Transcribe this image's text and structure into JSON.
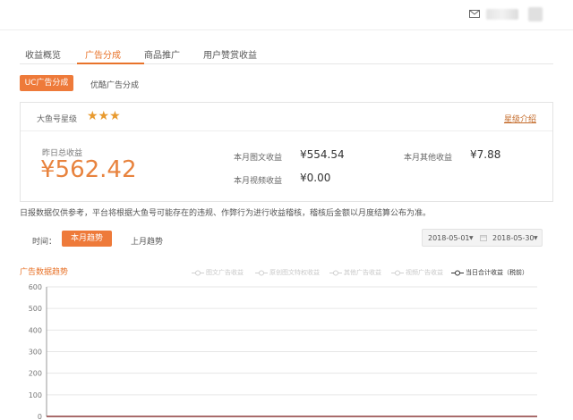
{
  "tabs": [
    {
      "label": "收益概览",
      "active": false
    },
    {
      "label": "广告分成",
      "active": true
    },
    {
      "label": "商品推广",
      "active": false
    },
    {
      "label": "用户赞赏收益",
      "active": false
    }
  ],
  "subtabs": {
    "active": "UC广告分成",
    "other": "优酷广告分成"
  },
  "star_panel": {
    "label": "大鱼号星级",
    "stars": "★★★",
    "link": "星级介绍"
  },
  "earnings": {
    "yesterday_label": "昨日总收益",
    "yesterday_value": "¥562.42",
    "stats": [
      {
        "label": "本月图文收益",
        "value": "¥554.54"
      },
      {
        "label": "本月其他收益",
        "value": "¥7.88"
      },
      {
        "label": "本月视频收益",
        "value": "¥0.00"
      }
    ]
  },
  "notice": "日报数据仅供参考，平台将根据大鱼号可能存在的违规、作弊行为进行收益稽核，稽核后金额以月度结算公布为准。",
  "time": {
    "label": "时间：",
    "active": "本月趋势",
    "other": "上月趋势"
  },
  "date_range": {
    "start": "2018-05-01",
    "end": "2018-05-30"
  },
  "chart_data": {
    "type": "line",
    "title": "广告数据趋势",
    "ylim": [
      0,
      600
    ],
    "yticks": [
      0,
      100,
      200,
      300,
      400,
      500,
      600
    ],
    "grid": true,
    "legend_position": "top-right",
    "series": [
      {
        "name": "图文广告收益",
        "visible": false,
        "values": []
      },
      {
        "name": "原创图文特权收益",
        "visible": false,
        "values": []
      },
      {
        "name": "其他广告收益",
        "visible": false,
        "values": []
      },
      {
        "name": "视频广告收益",
        "visible": false,
        "values": []
      },
      {
        "name": "当日合计收益（税前）",
        "visible": true,
        "values": []
      }
    ],
    "colors": {
      "accent": "#ee7a3a",
      "baseline": "#8b3a3a",
      "grid": "#e6e6e6"
    }
  },
  "icons": {
    "mail": "mail-icon",
    "calendar": "calendar-icon"
  }
}
